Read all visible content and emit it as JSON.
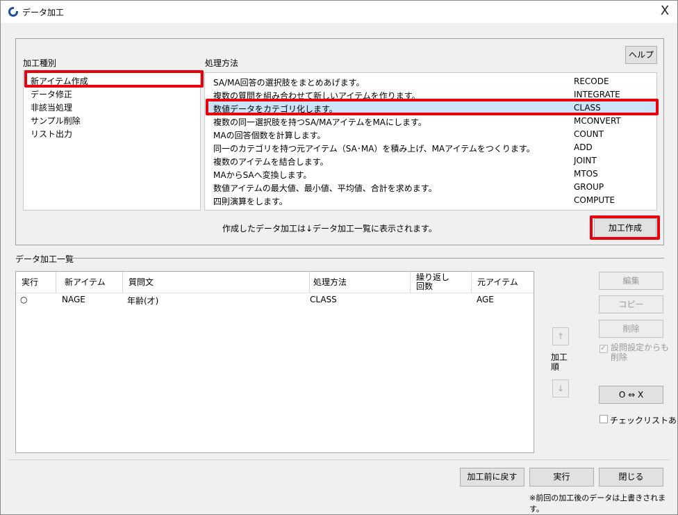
{
  "window": {
    "title": "データ加工",
    "close": "X"
  },
  "top": {
    "type_header": "加工種別",
    "method_header": "処理方法",
    "help_label": "ヘルプ",
    "types": [
      "新アイテム作成",
      "データ修正",
      "非該当処理",
      "サンプル削除",
      "リスト出力"
    ],
    "methods": [
      {
        "desc": "SA/MA回答の選択肢をまとめあげます。",
        "code": "RECODE"
      },
      {
        "desc": "複数の質問を組み合わせて新しいアイテムを作ります。",
        "code": "INTEGRATE"
      },
      {
        "desc": "数値データをカテゴリ化します。",
        "code": "CLASS"
      },
      {
        "desc": "複数の同一選択肢を持つSA/MAアイテムをMAにします。",
        "code": "MCONVERT"
      },
      {
        "desc": "MAの回答個数を計算します。",
        "code": "COUNT"
      },
      {
        "desc": "同一のカテゴリを持つ元アイテム（SA･MA）を積み上げ、MAアイテムをつくります。",
        "code": "ADD"
      },
      {
        "desc": "複数のアイテムを結合します。",
        "code": "JOINT"
      },
      {
        "desc": "MAからSAへ変換します。",
        "code": "MTOS"
      },
      {
        "desc": "数値アイテムの最大値、最小値、平均値、合計を求めます。",
        "code": "GROUP"
      },
      {
        "desc": "四則演算をします。",
        "code": "COMPUTE"
      }
    ],
    "info_text": "作成したデータ加工は↓データ加工一覧に表示されます。",
    "create_label": "加工作成"
  },
  "list": {
    "section_title": "データ加工一覧",
    "columns": [
      "実行",
      "新アイテム",
      "質問文",
      "処理方法",
      "繰り返し\n回数",
      "元アイテム"
    ],
    "rows": [
      {
        "run": "○",
        "new_item": "NAGE",
        "question": "年齢(才)",
        "method": "CLASS",
        "repeat": "",
        "source": "AGE"
      }
    ]
  },
  "side": {
    "edit_label": "編集",
    "copy_label": "コピー",
    "delete_label": "削除",
    "delete_from_settings": "設問設定からも\n削除",
    "order_label": "加工\n順",
    "up": "↑",
    "down": "↓",
    "toggle_label": "O ⇔ X",
    "checklist_label": "チェックリストあり"
  },
  "footer": {
    "revert_label": "加工前に戻す",
    "run_label": "実行",
    "close_label": "閉じる",
    "note": "※前回の加工後のデータは上書きされます。"
  }
}
